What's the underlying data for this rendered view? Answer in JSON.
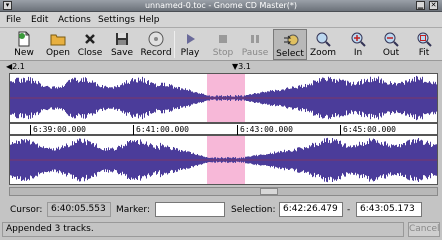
{
  "window": {
    "title": "unnamed-0.toc - Gnome CD Master(*)"
  },
  "menu": {
    "items": [
      "File",
      "Edit",
      "Actions",
      "Settings",
      "Help"
    ]
  },
  "toolbar": {
    "buttons": [
      {
        "label": "New",
        "icon": "new-document-icon"
      },
      {
        "label": "Open",
        "icon": "folder-open-icon"
      },
      {
        "label": "Close",
        "icon": "close-x-icon"
      },
      {
        "label": "Save",
        "icon": "floppy-disk-icon"
      },
      {
        "label": "Record",
        "icon": "cd-disc-icon"
      },
      {
        "label": "Play",
        "icon": "play-icon"
      },
      {
        "label": "Stop",
        "icon": "stop-icon"
      },
      {
        "label": "Pause",
        "icon": "pause-icon"
      },
      {
        "label": "Select",
        "icon": "select-cd-icon"
      },
      {
        "label": "Zoom",
        "icon": "magnifier-icon"
      },
      {
        "label": "In",
        "icon": "zoom-in-icon"
      },
      {
        "label": "Out",
        "icon": "zoom-out-icon"
      },
      {
        "label": "Fit",
        "icon": "zoom-fit-icon"
      }
    ],
    "active": "Select",
    "disabled": [
      "Stop",
      "Pause"
    ]
  },
  "markers": {
    "m1": "2.1",
    "m2": "3.1"
  },
  "timeline": {
    "ticks": [
      "6:39:00.000",
      "6:41:00.000",
      "6:43:00.000",
      "6:45:00.000"
    ]
  },
  "status": {
    "cursor_label": "Cursor:",
    "cursor_value": "6:40:05.553",
    "marker_label": "Marker:",
    "marker_value": "",
    "selection_label": "Selection:",
    "selection_start": "6:42:26.479",
    "selection_sep": "-",
    "selection_end": "6:43:05.173",
    "message": "Appended 3 tracks.",
    "cancel_label": "Cancel"
  },
  "colors": {
    "waveform": "#4b3c9a",
    "selection": "#f7b8d8",
    "centerline": "#b03030"
  }
}
